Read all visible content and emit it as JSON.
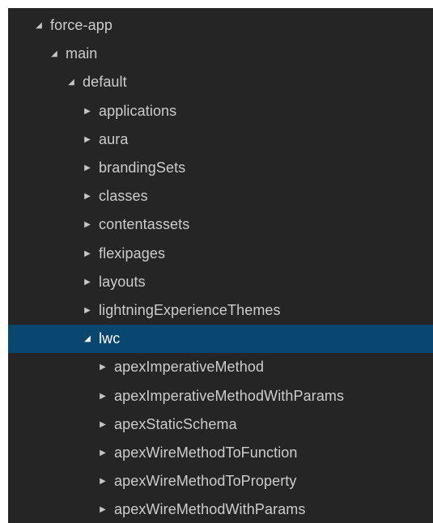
{
  "explorer": {
    "items": [
      {
        "label": "force-app",
        "expanded": true,
        "level": 0,
        "icon": "chevron-down-icon"
      },
      {
        "label": "main",
        "expanded": true,
        "level": 1,
        "icon": "chevron-down-icon"
      },
      {
        "label": "default",
        "expanded": true,
        "level": 2,
        "icon": "chevron-down-icon"
      },
      {
        "label": "applications",
        "expanded": false,
        "level": 3,
        "icon": "chevron-right-icon"
      },
      {
        "label": "aura",
        "expanded": false,
        "level": 3,
        "icon": "chevron-right-icon"
      },
      {
        "label": "brandingSets",
        "expanded": false,
        "level": 3,
        "icon": "chevron-right-icon"
      },
      {
        "label": "classes",
        "expanded": false,
        "level": 3,
        "icon": "chevron-right-icon"
      },
      {
        "label": "contentassets",
        "expanded": false,
        "level": 3,
        "icon": "chevron-right-icon"
      },
      {
        "label": "flexipages",
        "expanded": false,
        "level": 3,
        "icon": "chevron-right-icon"
      },
      {
        "label": "layouts",
        "expanded": false,
        "level": 3,
        "icon": "chevron-right-icon"
      },
      {
        "label": "lightningExperienceThemes",
        "expanded": false,
        "level": 3,
        "icon": "chevron-right-icon"
      },
      {
        "label": "lwc",
        "expanded": true,
        "level": 3,
        "icon": "chevron-down-icon",
        "selected": true
      },
      {
        "label": "apexImperativeMethod",
        "expanded": false,
        "level": 4,
        "icon": "chevron-right-icon"
      },
      {
        "label": "apexImperativeMethodWithParams",
        "expanded": false,
        "level": 4,
        "icon": "chevron-right-icon"
      },
      {
        "label": "apexStaticSchema",
        "expanded": false,
        "level": 4,
        "icon": "chevron-right-icon"
      },
      {
        "label": "apexWireMethodToFunction",
        "expanded": false,
        "level": 4,
        "icon": "chevron-right-icon"
      },
      {
        "label": "apexWireMethodToProperty",
        "expanded": false,
        "level": 4,
        "icon": "chevron-right-icon"
      },
      {
        "label": "apexWireMethodWithParams",
        "expanded": false,
        "level": 4,
        "icon": "chevron-right-icon"
      }
    ]
  },
  "colors": {
    "background": "#252526",
    "selection": "#094771",
    "text": "#cccccc"
  }
}
